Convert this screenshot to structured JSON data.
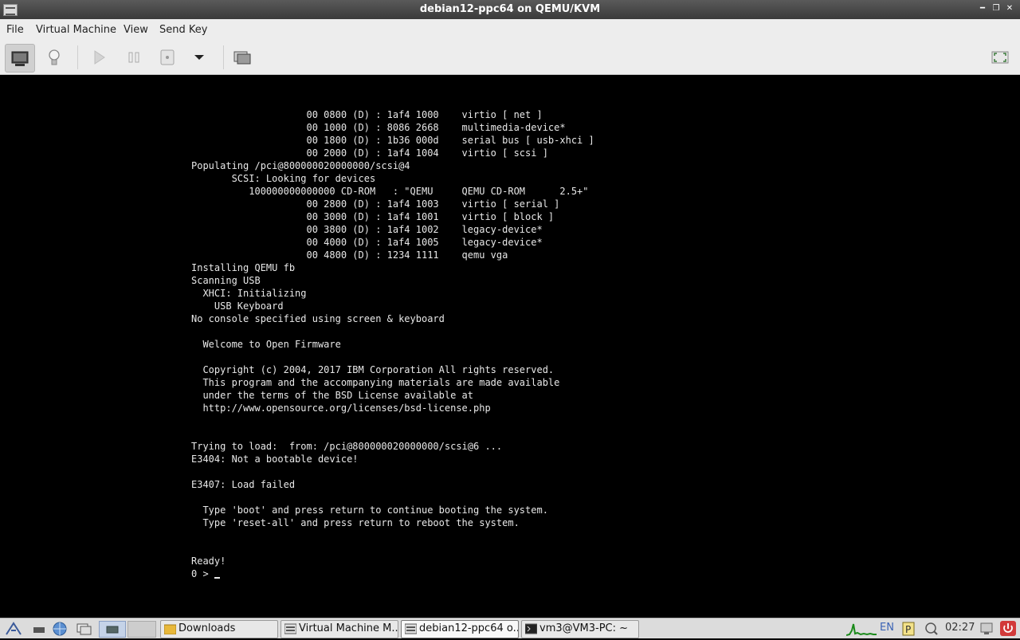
{
  "window": {
    "title": "debian12-ppc64 on QEMU/KVM"
  },
  "menu": {
    "file": "File",
    "vm": "Virtual Machine",
    "view": "View",
    "sendkey": "Send Key"
  },
  "toolbar": {
    "icons": [
      "console-icon",
      "details-bulb-icon",
      "run-icon",
      "pause-icon",
      "power-icon",
      "dropdown-icon",
      "snapshots-icon",
      "fullscreen-icon"
    ]
  },
  "console": {
    "lines": [
      "                    00 0800 (D) : 1af4 1000    virtio [ net ]",
      "                    00 1000 (D) : 8086 2668    multimedia-device*",
      "                    00 1800 (D) : 1b36 000d    serial bus [ usb-xhci ]",
      "                    00 2000 (D) : 1af4 1004    virtio [ scsi ]",
      "Populating /pci@800000020000000/scsi@4",
      "       SCSI: Looking for devices",
      "          100000000000000 CD-ROM   : \"QEMU     QEMU CD-ROM      2.5+\"",
      "                    00 2800 (D) : 1af4 1003    virtio [ serial ]",
      "                    00 3000 (D) : 1af4 1001    virtio [ block ]",
      "                    00 3800 (D) : 1af4 1002    legacy-device*",
      "                    00 4000 (D) : 1af4 1005    legacy-device*",
      "                    00 4800 (D) : 1234 1111    qemu vga",
      "Installing QEMU fb",
      "Scanning USB",
      "  XHCI: Initializing",
      "    USB Keyboard",
      "No console specified using screen & keyboard",
      "",
      "  Welcome to Open Firmware",
      "",
      "  Copyright (c) 2004, 2017 IBM Corporation All rights reserved.",
      "  This program and the accompanying materials are made available",
      "  under the terms of the BSD License available at",
      "  http://www.opensource.org/licenses/bsd-license.php",
      "",
      "",
      "Trying to load:  from: /pci@800000020000000/scsi@6 ...",
      "E3404: Not a bootable device!",
      "",
      "E3407: Load failed",
      "",
      "  Type 'boot' and press return to continue booting the system.",
      "  Type 'reset-all' and press return to reboot the system.",
      "",
      "",
      "Ready!"
    ],
    "prompt": "0 > "
  },
  "taskbar": {
    "tasks": [
      {
        "label": "Downloads",
        "icon": "folder-icon"
      },
      {
        "label": "Virtual Machine M...",
        "icon": "virt-manager-icon"
      },
      {
        "label": "debian12-ppc64 o...",
        "icon": "virt-manager-icon"
      },
      {
        "label": "vm3@VM3-PC: ~",
        "icon": "terminal-icon"
      }
    ],
    "lang": "EN",
    "clock": "02:27"
  },
  "colors": {
    "titlebar": "#4a4a4a",
    "menubar": "#ededed",
    "console_bg": "#000000",
    "console_fg": "#e8e8e8",
    "taskbar": "#dcdcdc"
  }
}
